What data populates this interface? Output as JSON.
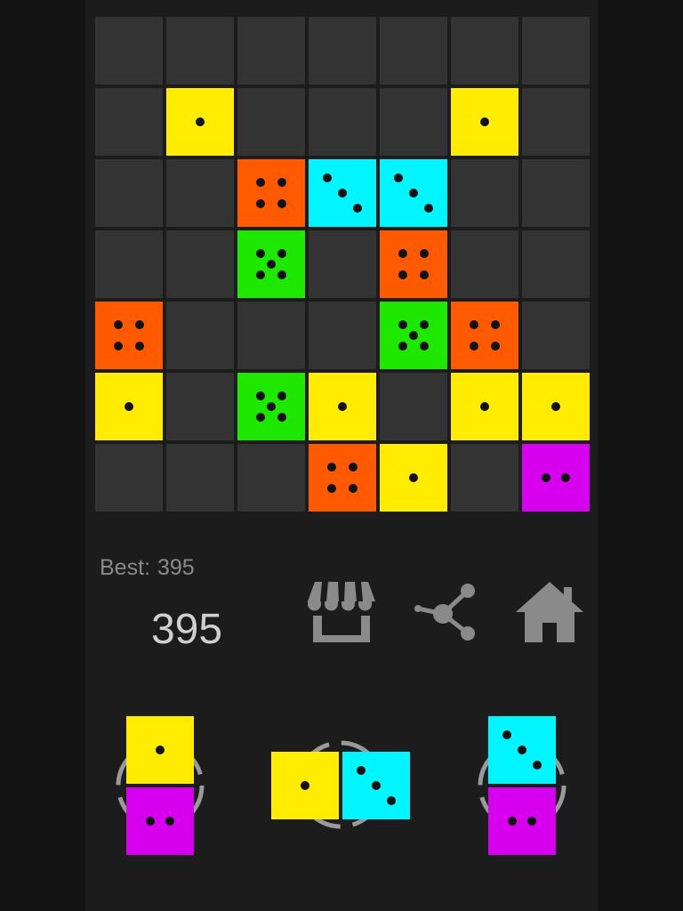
{
  "colors": {
    "empty": "#333333",
    "yellow": "#ffec00",
    "orange": "#ff5a00",
    "cyan": "#00f5ff",
    "green": "#1ee800",
    "magenta": "#d600ee",
    "pip": "#111111",
    "icon": "#8a8a8a"
  },
  "board": {
    "rows": 7,
    "cols": 7,
    "grid": [
      [
        null,
        null,
        null,
        null,
        null,
        null,
        null
      ],
      [
        null,
        {
          "color": "yellow",
          "value": 1
        },
        null,
        null,
        null,
        {
          "color": "yellow",
          "value": 1
        },
        null
      ],
      [
        null,
        null,
        {
          "color": "orange",
          "value": 4
        },
        {
          "color": "cyan",
          "value": 3
        },
        {
          "color": "cyan",
          "value": 3
        },
        null,
        null
      ],
      [
        null,
        null,
        {
          "color": "green",
          "value": 5
        },
        null,
        {
          "color": "orange",
          "value": 4
        },
        null,
        null
      ],
      [
        {
          "color": "orange",
          "value": 4
        },
        null,
        null,
        null,
        {
          "color": "green",
          "value": 5
        },
        {
          "color": "orange",
          "value": 4
        },
        null
      ],
      [
        {
          "color": "yellow",
          "value": 1
        },
        null,
        {
          "color": "green",
          "value": 5
        },
        {
          "color": "yellow",
          "value": 1
        },
        null,
        {
          "color": "yellow",
          "value": 1
        },
        {
          "color": "yellow",
          "value": 1
        }
      ],
      [
        null,
        null,
        null,
        {
          "color": "orange",
          "value": 4
        },
        {
          "color": "yellow",
          "value": 1
        },
        null,
        {
          "color": "magenta",
          "value": 2
        }
      ]
    ]
  },
  "score": {
    "best_label": "Best:",
    "best_value": "395",
    "current": "395"
  },
  "toolbar": {
    "shop_icon": "shop-icon",
    "share_icon": "share-icon",
    "home_icon": "home-icon"
  },
  "pieces": [
    {
      "orientation": "vertical",
      "dice": [
        {
          "color": "yellow",
          "value": 1
        },
        {
          "color": "magenta",
          "value": 2
        }
      ]
    },
    {
      "orientation": "horizontal",
      "dice": [
        {
          "color": "yellow",
          "value": 1
        },
        {
          "color": "cyan",
          "value": 3
        }
      ]
    },
    {
      "orientation": "vertical",
      "dice": [
        {
          "color": "cyan",
          "value": 3
        },
        {
          "color": "magenta",
          "value": 2
        }
      ]
    }
  ]
}
